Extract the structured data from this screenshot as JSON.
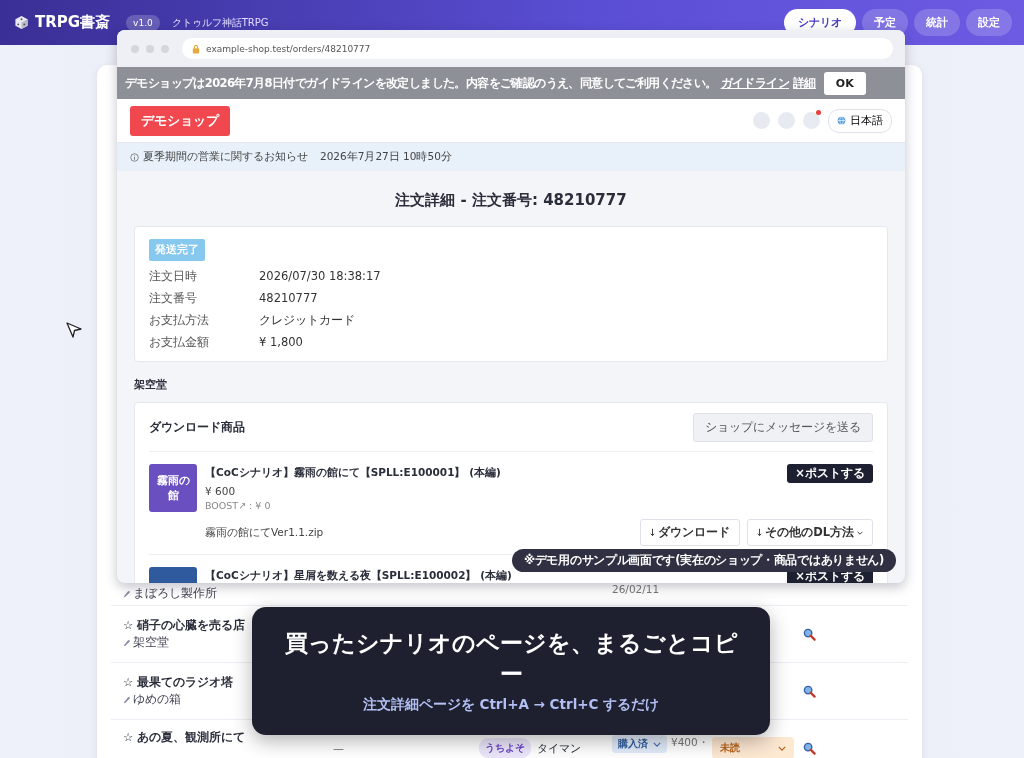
{
  "app_bar": {
    "logo": "TRPG書斎",
    "version": "v1.0",
    "subtitle": "クトゥルフ神話TRPG",
    "nav": [
      {
        "label": "シナリオ",
        "selected": true
      },
      {
        "label": "予定",
        "selected": false
      },
      {
        "label": "統計",
        "selected": false
      },
      {
        "label": "設定",
        "selected": false
      }
    ]
  },
  "scenario_rows": [
    {
      "shop": "まぼろし製作所",
      "date": "26/02/11"
    },
    {
      "title": "☆ 硝子の心臓を売る店",
      "shop": "架空堂",
      "search": true
    },
    {
      "title": "☆ 最果てのラジオ塔",
      "shop": "ゆめの箱",
      "search": true
    },
    {
      "title": "☆ あの夏、観測所にて",
      "players": "—",
      "tag": "うちよそ",
      "type": "タイマン",
      "purchase": "購入済",
      "price": "¥400・",
      "status": "未読",
      "search": true
    }
  ],
  "browser": {
    "url": "example-shop.test/orders/48210777",
    "notice_banner": {
      "text": "デモショップは2026年7月8日付でガイドラインを改定しました。内容をご確認のうえ、同意してご利用ください。",
      "links": [
        "ガイドライン",
        "詳細"
      ],
      "button": "OK"
    },
    "shop_header": {
      "logo": "デモショップ",
      "icons": [
        {
          "badge": false
        },
        {
          "badge": false
        },
        {
          "badge": true
        }
      ],
      "language": "日本語"
    },
    "announcement": {
      "text": "夏季期間の営業に関するお知らせ",
      "date": "2026年7月27日 10時50分"
    },
    "page_title": "注文詳細 - 注文番号: 48210777",
    "order": {
      "status": "発送完了",
      "fields": [
        {
          "label": "注文日時",
          "value": "2026/07/30 18:38:17"
        },
        {
          "label": "注文番号",
          "value": "48210777"
        },
        {
          "label": "お支払方法",
          "value": "クレジットカード"
        },
        {
          "label": "お支払金額",
          "value": "¥ 1,800"
        }
      ]
    },
    "seller": "架空堂",
    "downloads": {
      "title": "ダウンロード商品",
      "message_button": "ショップにメッセージを送る",
      "items": [
        {
          "cover": "霧雨の館",
          "color": "#6a4fc0",
          "title": "【CoCシナリオ】霧雨の館にて【SPLL:E100001】 (本編)",
          "price": "¥ 600",
          "boost": "BOOST↗ : ¥ 0",
          "file": "霧雨の館にてVer1.1.zip",
          "download_button": "ダウンロード",
          "other_button": "その他のDL方法",
          "post_button": "×ポストする"
        },
        {
          "color": "#2f5a9e",
          "title": "【CoCシナリオ】星屑を数える夜【SPLL:E100002】 (本編)",
          "post_button": "×ポストする"
        }
      ]
    }
  },
  "tooltip": "※デモ用のサンプル画面です(実在のショップ・商品ではありません)",
  "caption": {
    "headline": "買ったシナリオのページを、まるごとコピー",
    "subline": "注文詳細ページを Ctrl+A → Ctrl+C するだけ"
  }
}
